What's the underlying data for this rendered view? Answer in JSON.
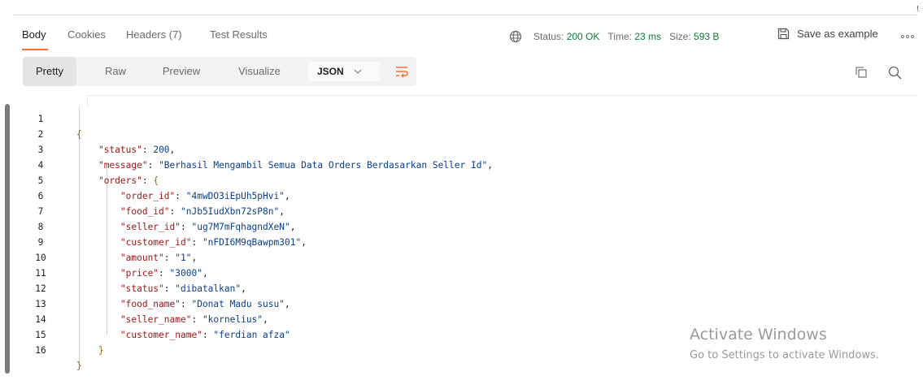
{
  "response_tabs": {
    "body": "Body",
    "cookies": "Cookies",
    "headers": "Headers (7)",
    "test_results": "Test Results"
  },
  "status": {
    "status_label": "Status:",
    "status_value": "200 OK",
    "time_label": "Time:",
    "time_value": "23 ms",
    "size_label": "Size:",
    "size_value": "593 B"
  },
  "save_example": "Save as example",
  "view_modes": [
    "Pretty",
    "Raw",
    "Preview",
    "Visualize"
  ],
  "format_select": "JSON",
  "code_lines": [
    {
      "n": "1"
    },
    {
      "n": "2"
    },
    {
      "n": "3"
    },
    {
      "n": "4"
    },
    {
      "n": "5"
    },
    {
      "n": "6"
    },
    {
      "n": "7"
    },
    {
      "n": "8"
    },
    {
      "n": "9"
    },
    {
      "n": "10"
    },
    {
      "n": "11"
    },
    {
      "n": "12"
    },
    {
      "n": "13"
    },
    {
      "n": "14"
    },
    {
      "n": "15"
    },
    {
      "n": "16"
    }
  ],
  "json": {
    "k_status": "\"status\"",
    "v_status": "200",
    "k_message": "\"message\"",
    "v_message": "\"Berhasil Mengambil Semua Data Orders Berdasarkan Seller Id\"",
    "k_orders": "\"orders\"",
    "k_order_id": "\"order_id\"",
    "v_order_id": "\"4mwDO3iEpUh5pHvi\"",
    "k_food_id": "\"food_id\"",
    "v_food_id": "\"nJb5IudXbn72sP8n\"",
    "k_seller_id": "\"seller_id\"",
    "v_seller_id": "\"ug7M7mFqhagndXeN\"",
    "k_customer_id": "\"customer_id\"",
    "v_customer_id": "\"nFDI6M9qBawpm301\"",
    "k_amount": "\"amount\"",
    "v_amount": "\"1\"",
    "k_price": "\"price\"",
    "v_price": "\"3000\"",
    "k_status2": "\"status\"",
    "v_status2": "\"dibatalkan\"",
    "k_food_name": "\"food_name\"",
    "v_food_name": "\"Donat Madu susu\"",
    "k_seller_name": "\"seller_name\"",
    "v_seller_name": "\"kornelius\"",
    "k_customer_name": "\"customer_name\"",
    "v_customer_name": "\"ferdian afza\""
  },
  "watermark": {
    "title": "Activate Windows",
    "subtitle": "Go to Settings to activate Windows."
  },
  "colors": {
    "accent": "#ff6c37",
    "status_ok": "#0c7d35",
    "json_key": "#a01818",
    "json_value": "#0b3e8c"
  },
  "icons": {
    "globe": "globe-icon",
    "save": "save-icon",
    "more": "more-icon",
    "chevron": "chevron-down-icon",
    "wrap": "wrap-lines-icon",
    "copy": "copy-icon",
    "search": "search-icon"
  }
}
